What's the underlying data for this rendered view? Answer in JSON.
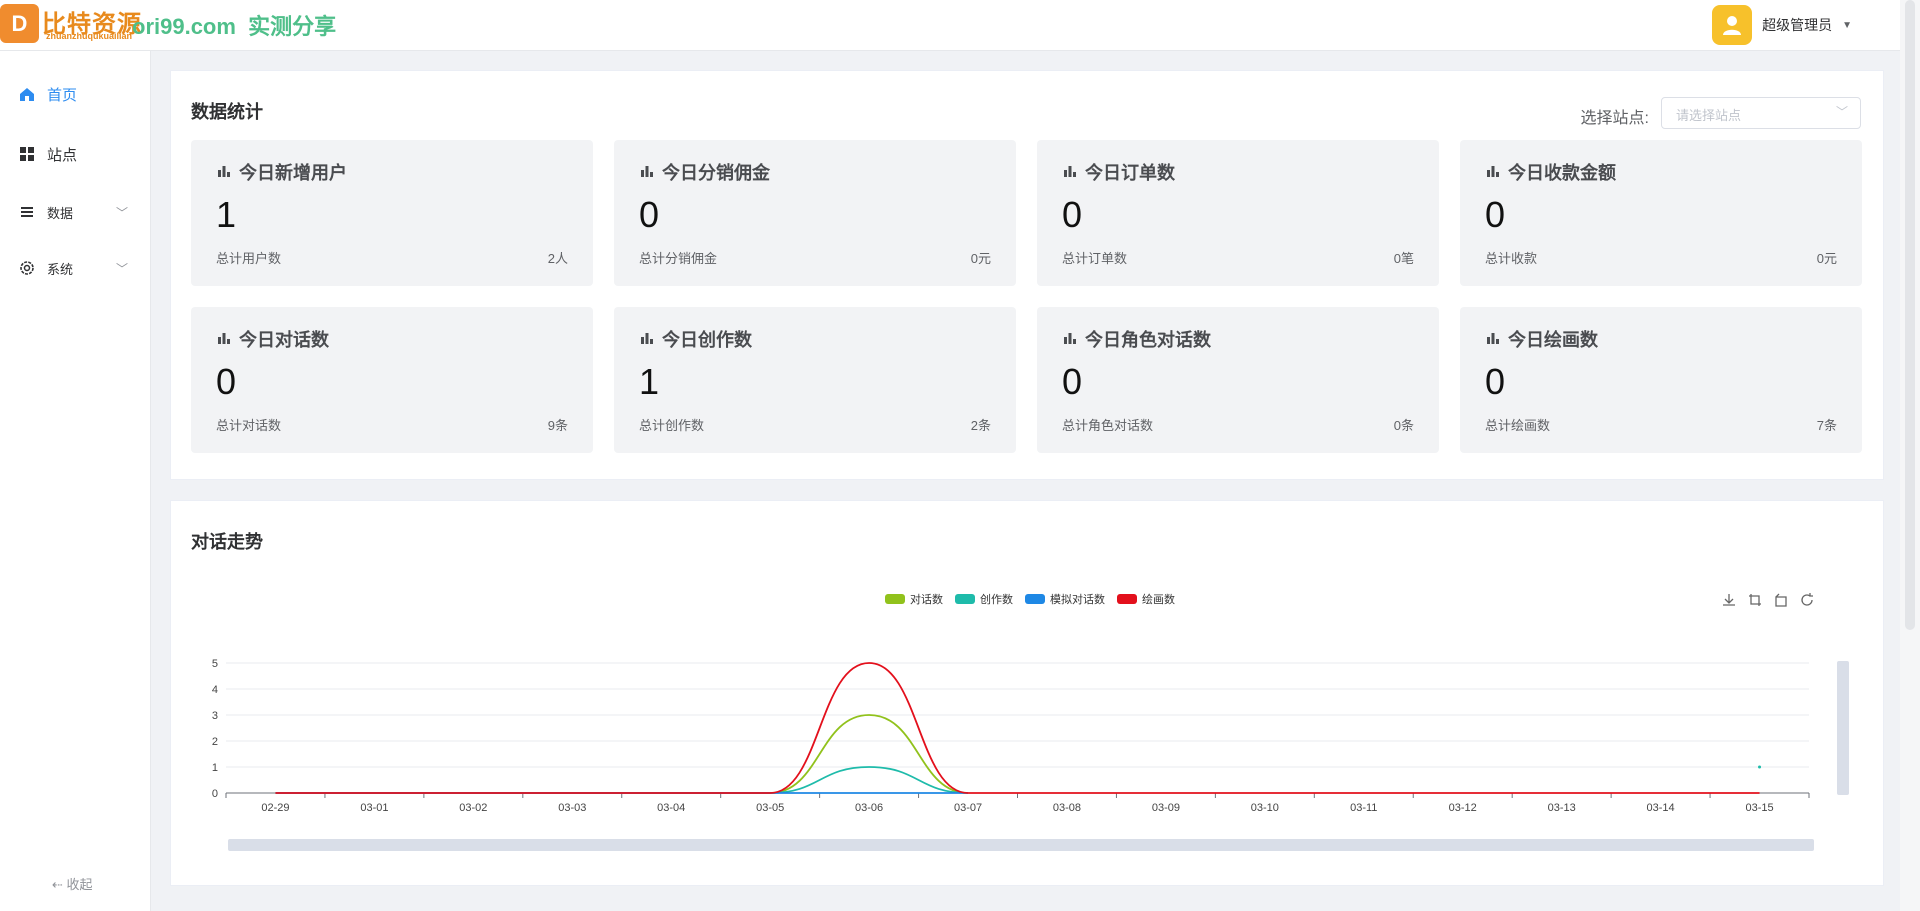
{
  "header": {
    "logo_letter": "D",
    "watermark_cn": "比特资源",
    "watermark_url": "ori99.com",
    "watermark_tag": "实测分享",
    "watermark_pinyin": "zhuanzhuqukuailian",
    "username": "超级管理员"
  },
  "sidebar": {
    "items": [
      {
        "label": "首页",
        "icon": "home-icon",
        "active": true
      },
      {
        "label": "站点",
        "icon": "grid-icon",
        "active": false
      },
      {
        "label": "数据",
        "icon": "list-icon",
        "active": false,
        "expandable": true
      },
      {
        "label": "系统",
        "icon": "gear-icon",
        "active": false,
        "expandable": true
      }
    ],
    "collapse_label": "收起"
  },
  "stats_card": {
    "title": "数据统计",
    "site_label": "选择站点:",
    "site_placeholder": "请选择站点",
    "items": [
      {
        "title": "今日新增用户",
        "value": "1",
        "sub": "总计用户数",
        "total": "2人"
      },
      {
        "title": "今日分销佣金",
        "value": "0",
        "sub": "总计分销佣金",
        "total": "0元"
      },
      {
        "title": "今日订单数",
        "value": "0",
        "sub": "总计订单数",
        "total": "0笔"
      },
      {
        "title": "今日收款金额",
        "value": "0",
        "sub": "总计收款",
        "total": "0元"
      },
      {
        "title": "今日对话数",
        "value": "0",
        "sub": "总计对话数",
        "total": "9条"
      },
      {
        "title": "今日创作数",
        "value": "1",
        "sub": "总计创作数",
        "total": "2条"
      },
      {
        "title": "今日角色对话数",
        "value": "0",
        "sub": "总计角色对话数",
        "total": "0条"
      },
      {
        "title": "今日绘画数",
        "value": "0",
        "sub": "总计绘画数",
        "total": "7条"
      }
    ]
  },
  "trend_card": {
    "title": "对话走势",
    "tools": [
      "download-icon",
      "zoom-icon",
      "zoom-reset-icon",
      "refresh-icon"
    ]
  },
  "chart_data": {
    "type": "line",
    "smooth": true,
    "categories": [
      "02-29",
      "03-01",
      "03-02",
      "03-03",
      "03-04",
      "03-05",
      "03-06",
      "03-07",
      "03-08",
      "03-09",
      "03-10",
      "03-11",
      "03-12",
      "03-13",
      "03-14",
      "03-15"
    ],
    "ylim": [
      0,
      5
    ],
    "yticks": [
      0,
      1,
      2,
      3,
      4,
      5
    ],
    "grid": true,
    "legend_position": "top-center",
    "series": [
      {
        "name": "对话数",
        "color": "#91c21c",
        "values": [
          0,
          0,
          0,
          0,
          0,
          0,
          3,
          0,
          null,
          null,
          null,
          null,
          null,
          null,
          null,
          null
        ]
      },
      {
        "name": "创作数",
        "color": "#1ebbaa",
        "values": [
          0,
          0,
          0,
          0,
          0,
          0,
          1,
          0,
          null,
          null,
          null,
          null,
          null,
          null,
          null,
          1
        ]
      },
      {
        "name": "模拟对话数",
        "color": "#1e88e5",
        "values": [
          0,
          0,
          0,
          0,
          0,
          0,
          0,
          0,
          null,
          null,
          null,
          null,
          null,
          null,
          null,
          null
        ]
      },
      {
        "name": "绘画数",
        "color": "#e3101c",
        "values": [
          0,
          0,
          0,
          0,
          0,
          0,
          5,
          0,
          0,
          0,
          0,
          0,
          0,
          0,
          0,
          0
        ]
      }
    ]
  }
}
